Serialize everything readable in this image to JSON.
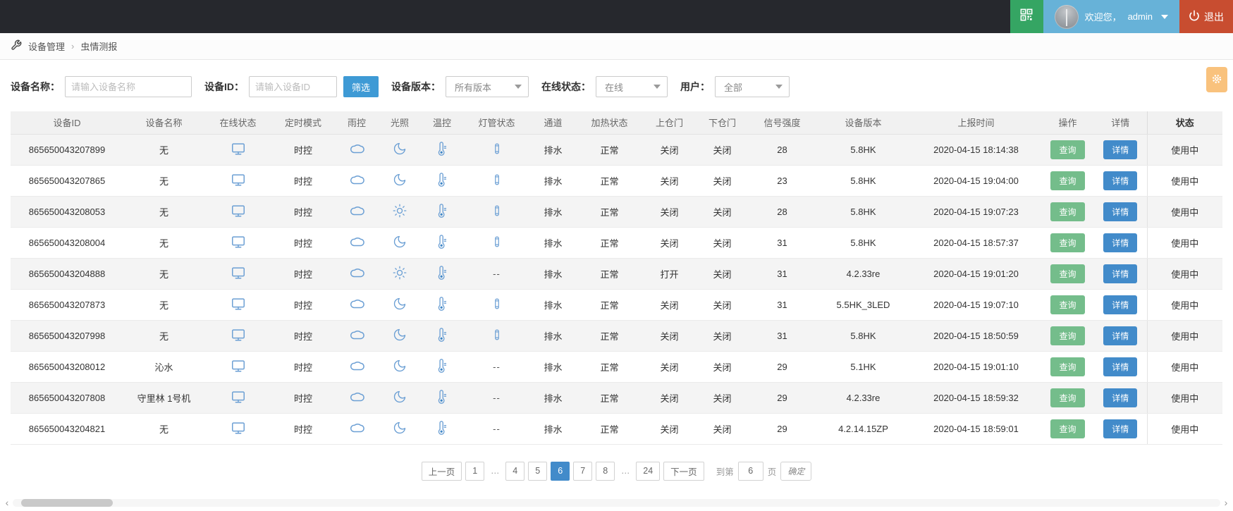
{
  "topbar": {
    "welcome": "欢迎您，",
    "username": "admin",
    "logout": "退出"
  },
  "breadcrumb": {
    "items": [
      "设备管理",
      "虫情测报"
    ],
    "separator": "›"
  },
  "filters": {
    "device_name_label": "设备名称：",
    "device_name_placeholder": "请输入设备名称",
    "device_id_label": "设备ID：",
    "device_id_placeholder": "请输入设备ID",
    "filter_button": "筛选",
    "version_label": "设备版本：",
    "version_value": "所有版本",
    "online_label": "在线状态：",
    "online_value": "在线",
    "user_label": "用户：",
    "user_value": "全部"
  },
  "table": {
    "headers": [
      "设备ID",
      "设备名称",
      "在线状态",
      "定时模式",
      "雨控",
      "光照",
      "温控",
      "灯管状态",
      "通道",
      "加热状态",
      "上仓门",
      "下仓门",
      "信号强度",
      "设备版本",
      "上报时间",
      "操作",
      "详情",
      "状态"
    ],
    "action_label": "查询",
    "detail_label": "详情",
    "rows": [
      {
        "device_id": "865650043207899",
        "device_name": "无",
        "online": "monitor",
        "mode": "时控",
        "rain": "cloud",
        "light": "moon",
        "temp": "thermometer",
        "lamp": "tube",
        "channel": "排水",
        "heat": "正常",
        "door_up": "关闭",
        "door_down": "关闭",
        "signal": "28",
        "version": "5.8HK",
        "report_time": "2020-04-15 18:14:38",
        "status": "使用中"
      },
      {
        "device_id": "865650043207865",
        "device_name": "无",
        "online": "monitor",
        "mode": "时控",
        "rain": "cloud",
        "light": "moon",
        "temp": "thermometer",
        "lamp": "tube",
        "channel": "排水",
        "heat": "正常",
        "door_up": "关闭",
        "door_down": "关闭",
        "signal": "23",
        "version": "5.8HK",
        "report_time": "2020-04-15 19:04:00",
        "status": "使用中"
      },
      {
        "device_id": "865650043208053",
        "device_name": "无",
        "online": "monitor",
        "mode": "时控",
        "rain": "cloud",
        "light": "sun",
        "temp": "thermometer",
        "lamp": "tube",
        "channel": "排水",
        "heat": "正常",
        "door_up": "关闭",
        "door_down": "关闭",
        "signal": "28",
        "version": "5.8HK",
        "report_time": "2020-04-15 19:07:23",
        "status": "使用中"
      },
      {
        "device_id": "865650043208004",
        "device_name": "无",
        "online": "monitor",
        "mode": "时控",
        "rain": "cloud",
        "light": "moon",
        "temp": "thermometer",
        "lamp": "tube",
        "channel": "排水",
        "heat": "正常",
        "door_up": "关闭",
        "door_down": "关闭",
        "signal": "31",
        "version": "5.8HK",
        "report_time": "2020-04-15 18:57:37",
        "status": "使用中"
      },
      {
        "device_id": "865650043204888",
        "device_name": "无",
        "online": "monitor",
        "mode": "时控",
        "rain": "cloud",
        "light": "sun",
        "temp": "thermometer",
        "lamp": "--",
        "channel": "排水",
        "heat": "正常",
        "door_up": "打开",
        "door_down": "关闭",
        "signal": "31",
        "version": "4.2.33re",
        "report_time": "2020-04-15 19:01:20",
        "status": "使用中"
      },
      {
        "device_id": "865650043207873",
        "device_name": "无",
        "online": "monitor",
        "mode": "时控",
        "rain": "cloud",
        "light": "moon",
        "temp": "thermometer",
        "lamp": "tube",
        "channel": "排水",
        "heat": "正常",
        "door_up": "关闭",
        "door_down": "关闭",
        "signal": "31",
        "version": "5.5HK_3LED",
        "report_time": "2020-04-15 19:07:10",
        "status": "使用中"
      },
      {
        "device_id": "865650043207998",
        "device_name": "无",
        "online": "monitor",
        "mode": "时控",
        "rain": "cloud",
        "light": "moon",
        "temp": "thermometer",
        "lamp": "tube",
        "channel": "排水",
        "heat": "正常",
        "door_up": "关闭",
        "door_down": "关闭",
        "signal": "31",
        "version": "5.8HK",
        "report_time": "2020-04-15 18:50:59",
        "status": "使用中"
      },
      {
        "device_id": "865650043208012",
        "device_name": "沁水",
        "online": "monitor",
        "mode": "时控",
        "rain": "cloud",
        "light": "moon",
        "temp": "thermometer",
        "lamp": "--",
        "channel": "排水",
        "heat": "正常",
        "door_up": "关闭",
        "door_down": "关闭",
        "signal": "29",
        "version": "5.1HK",
        "report_time": "2020-04-15 19:01:10",
        "status": "使用中"
      },
      {
        "device_id": "865650043207808",
        "device_name": "守里林 1号机",
        "online": "monitor",
        "mode": "时控",
        "rain": "cloud",
        "light": "moon",
        "temp": "thermometer",
        "lamp": "--",
        "channel": "排水",
        "heat": "正常",
        "door_up": "关闭",
        "door_down": "关闭",
        "signal": "29",
        "version": "4.2.33re",
        "report_time": "2020-04-15 18:59:32",
        "status": "使用中"
      },
      {
        "device_id": "865650043204821",
        "device_name": "无",
        "online": "monitor",
        "mode": "时控",
        "rain": "cloud",
        "light": "moon",
        "temp": "thermometer",
        "lamp": "--",
        "channel": "排水",
        "heat": "正常",
        "door_up": "关闭",
        "door_down": "关闭",
        "signal": "29",
        "version": "4.2.14.15ZP",
        "report_time": "2020-04-15 18:59:01",
        "status": "使用中"
      }
    ]
  },
  "pagination": {
    "prev": "上一页",
    "pages": [
      "1",
      "…",
      "4",
      "5",
      "6",
      "7",
      "8",
      "…",
      "24"
    ],
    "active": "6",
    "next": "下一页",
    "goto_prefix": "到第",
    "goto_value": "6",
    "goto_suffix": "页",
    "confirm": "确定"
  },
  "colors": {
    "topbar_bg": "#26282d",
    "qr_green": "#35a563",
    "user_blue": "#67b2d8",
    "logout_red": "#c84d30",
    "primary_blue": "#428bca",
    "filter_blue": "#3e9ad5",
    "action_green": "#74bd8b",
    "gear_orange": "#f9c27d",
    "icon_blue": "#6b9fd4"
  }
}
